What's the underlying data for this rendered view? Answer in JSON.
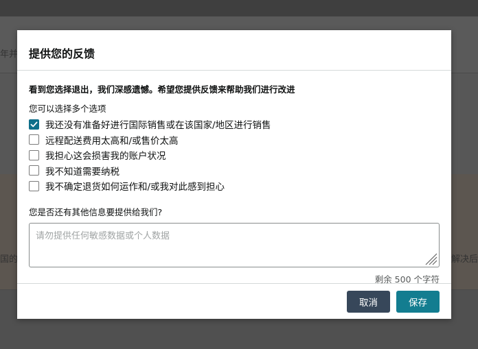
{
  "background": {
    "left_top_text": "年并点",
    "left_mid_text": "国的",
    "right_mid_text": "解决后"
  },
  "modal": {
    "title": "提供您的反馈",
    "intro": "看到您选择退出，我们深感遗憾。希望您提供反馈来帮助我们进行改进",
    "multi_hint": "您可以选择多个选项",
    "options": [
      {
        "label": "我还没有准备好进行国际销售或在该国家/地区进行销售",
        "checked": true
      },
      {
        "label": "远程配送费用太高和/或售价太高",
        "checked": false
      },
      {
        "label": "我担心这会损害我的账户状况",
        "checked": false
      },
      {
        "label": "我不知道需要纳税",
        "checked": false
      },
      {
        "label": "我不确定退货如何运作和/或我对此感到担心",
        "checked": false
      }
    ],
    "question": "您是否还有其他信息要提供给我们?",
    "textarea": {
      "value": "",
      "placeholder": "请勿提供任何敏感数据或个人数据"
    },
    "char_remaining": "剩余 500 个字符",
    "cancel_label": "取消",
    "save_label": "保存"
  },
  "colors": {
    "overlay": "#575757",
    "checkbox_checked": "#0f6f8a",
    "cancel_button": "#37475a",
    "save_button": "#137d90"
  }
}
